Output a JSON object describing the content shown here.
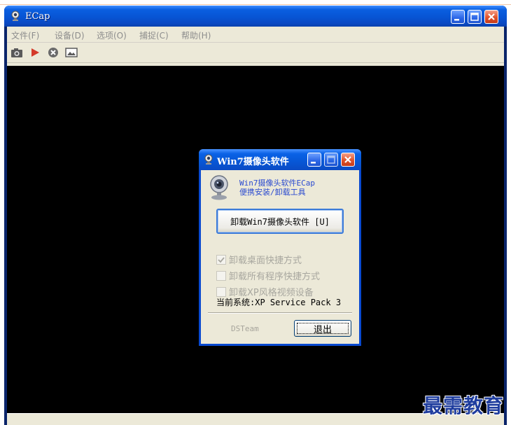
{
  "app": {
    "title": "ECap"
  },
  "menu": [
    "文件(F)",
    "设备(D)",
    "选项(O)",
    "捕捉(C)",
    "帮助(H)"
  ],
  "toolbar": {
    "icons": [
      "camera-icon",
      "play-icon",
      "stop-icon",
      "picture-icon"
    ]
  },
  "dialog": {
    "title": "Win7摄像头软件",
    "desc_line1": "Win7摄像头软件ECap",
    "desc_line2": "便携安装/卸载工具",
    "uninstall_button": "卸载Win7摄像头软件 [U]",
    "options": [
      {
        "label": "卸载桌面快捷方式",
        "checked": true
      },
      {
        "label": "卸载所有程序快捷方式",
        "checked": false
      },
      {
        "label": "卸载XP风格视频设备",
        "checked": false
      }
    ],
    "system_text": "当前系统:XP Service Pack 3",
    "team": "DSTeam",
    "exit_button": "退出"
  },
  "watermark": "最需教育",
  "colors": {
    "titlebar": "#0754d4",
    "video": "#000000",
    "close": "#e0532b"
  }
}
